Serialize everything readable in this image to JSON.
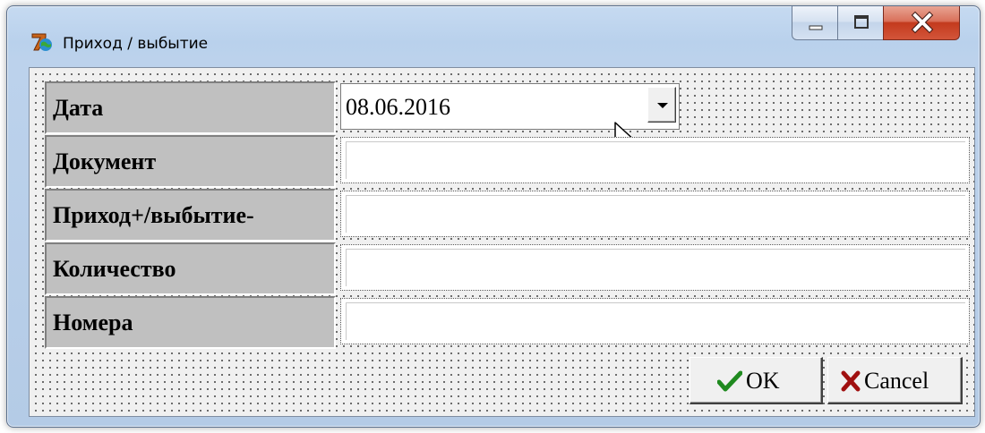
{
  "window": {
    "title": "Приход / выбытие"
  },
  "form": {
    "rows": [
      {
        "label": "Дата",
        "value": "08.06.2016"
      },
      {
        "label": "Документ",
        "value": ""
      },
      {
        "label": "Приход+/выбытие-",
        "value": ""
      },
      {
        "label": "Количество",
        "value": ""
      },
      {
        "label": "Номера",
        "value": ""
      }
    ]
  },
  "buttons": {
    "ok": {
      "label": "OK",
      "icon": "check-icon",
      "color": "#1f8a1f"
    },
    "cancel": {
      "label": "Cancel",
      "icon": "x-icon",
      "color": "#a01010"
    }
  },
  "colors": {
    "label_bg": "#c0c0c0",
    "client_bg": "#f0f0f0",
    "titlebar": "#b9d1ec",
    "close_button": "#c33a1d"
  }
}
